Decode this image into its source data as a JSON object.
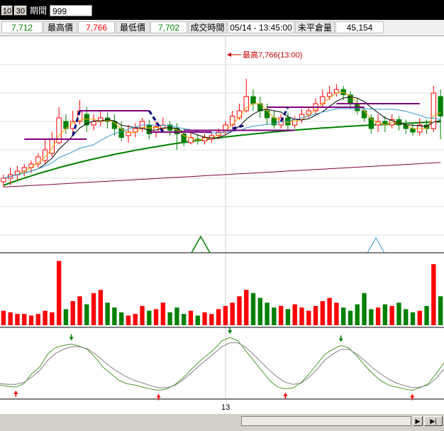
{
  "toolbar": {
    "btn_10": "10",
    "btn_30": "30",
    "period_label": "期間",
    "period_value": "999"
  },
  "info": {
    "last_value": "7,712",
    "high_label": "最高價",
    "high_value": "7,766",
    "low_label": "最低價",
    "low_value": "7,702",
    "time_label": "成交時間",
    "time_value": "05/14 - 13:45:00",
    "oi_label": "未平倉量",
    "oi_value": "45,154"
  },
  "colors": {
    "up": "#ff0000",
    "down": "#008000",
    "ma_long": "#008000",
    "ma_slow": "#800040",
    "ma_mid": "#000000",
    "ma_fast": "#ffa500",
    "ma_blue": "#3399cc",
    "box_line": "#800080",
    "dash_line": "#000080"
  },
  "chart_data": {
    "type": "candlestick",
    "annotation": "最高7,766(13:00)",
    "x_tick_label": "13",
    "price_axis_min": 7690,
    "price_axis_max": 7790,
    "candles": [
      [
        7708,
        7710,
        7705,
        7712
      ],
      [
        7710,
        7712,
        7706,
        7716
      ],
      [
        7712,
        7714,
        7709,
        7717
      ],
      [
        7714,
        7716,
        7711,
        7718
      ],
      [
        7716,
        7718,
        7713,
        7720
      ],
      [
        7718,
        7722,
        7716,
        7724
      ],
      [
        7720,
        7726,
        7718,
        7732
      ],
      [
        7724,
        7732,
        7722,
        7736
      ],
      [
        7730,
        7744,
        7729,
        7750
      ],
      [
        7742,
        7738,
        7735,
        7746
      ],
      [
        7738,
        7742,
        7734,
        7748
      ],
      [
        7742,
        7748,
        7740,
        7754
      ],
      [
        7746,
        7740,
        7736,
        7750
      ],
      [
        7740,
        7742,
        7737,
        7746
      ],
      [
        7742,
        7744,
        7739,
        7748
      ],
      [
        7744,
        7742,
        7738,
        7747
      ],
      [
        7742,
        7738,
        7734,
        7746
      ],
      [
        7738,
        7733,
        7731,
        7742
      ],
      [
        7734,
        7736,
        7730,
        7740
      ],
      [
        7736,
        7738,
        7733,
        7741
      ],
      [
        7738,
        7742,
        7736,
        7744
      ],
      [
        7740,
        7735,
        7732,
        7743
      ],
      [
        7736,
        7739,
        7733,
        7742
      ],
      [
        7738,
        7740,
        7736,
        7744
      ],
      [
        7740,
        7737,
        7734,
        7742
      ],
      [
        7738,
        7735,
        7726,
        7741
      ],
      [
        7735,
        7730,
        7728,
        7738
      ],
      [
        7730,
        7733,
        7729,
        7736
      ],
      [
        7732,
        7731,
        7729,
        7735
      ],
      [
        7731,
        7733,
        7729,
        7735
      ],
      [
        7732,
        7734,
        7730,
        7736
      ],
      [
        7734,
        7736,
        7732,
        7738
      ],
      [
        7736,
        7740,
        7734,
        7742
      ],
      [
        7740,
        7745,
        7739,
        7748
      ],
      [
        7744,
        7748,
        7743,
        7752
      ],
      [
        7748,
        7756,
        7747,
        7766
      ],
      [
        7756,
        7752,
        7748,
        7760
      ],
      [
        7752,
        7748,
        7744,
        7756
      ],
      [
        7748,
        7744,
        7740,
        7752
      ],
      [
        7744,
        7740,
        7738,
        7748
      ],
      [
        7740,
        7744,
        7738,
        7746
      ],
      [
        7744,
        7740,
        7737,
        7747
      ],
      [
        7740,
        7743,
        7738,
        7745
      ],
      [
        7743,
        7746,
        7741,
        7749
      ],
      [
        7746,
        7748,
        7744,
        7750
      ],
      [
        7748,
        7752,
        7746,
        7755
      ],
      [
        7752,
        7756,
        7750,
        7760
      ],
      [
        7756,
        7758,
        7754,
        7762
      ],
      [
        7758,
        7760,
        7756,
        7763
      ],
      [
        7760,
        7757,
        7754,
        7762
      ],
      [
        7757,
        7752,
        7749,
        7759
      ],
      [
        7752,
        7748,
        7746,
        7755
      ],
      [
        7748,
        7744,
        7742,
        7750
      ],
      [
        7744,
        7738,
        7735,
        7746
      ],
      [
        7740,
        7742,
        7736,
        7746
      ],
      [
        7742,
        7740,
        7736,
        7745
      ],
      [
        7740,
        7743,
        7738,
        7746
      ],
      [
        7743,
        7740,
        7737,
        7745
      ],
      [
        7740,
        7738,
        7735,
        7743
      ],
      [
        7738,
        7736,
        7734,
        7741
      ],
      [
        7736,
        7740,
        7734,
        7744
      ],
      [
        7740,
        7738,
        7735,
        7743
      ],
      [
        7738,
        7758,
        7736,
        7762
      ],
      [
        7756,
        7745,
        7732,
        7760
      ]
    ],
    "volume": [
      9,
      8,
      7,
      7,
      6,
      7,
      9,
      8,
      40,
      10,
      15,
      18,
      13,
      20,
      22,
      14,
      11,
      8,
      6,
      7,
      12,
      9,
      10,
      14,
      8,
      11,
      7,
      9,
      6,
      8,
      7,
      10,
      12,
      14,
      18,
      22,
      20,
      17,
      14,
      11,
      12,
      10,
      13,
      11,
      9,
      12,
      15,
      17,
      14,
      11,
      9,
      13,
      20,
      10,
      11,
      13,
      12,
      14,
      10,
      8,
      9,
      12,
      38,
      18
    ],
    "macd_fast": [
      18,
      16,
      15,
      20,
      35,
      45,
      65,
      75,
      78,
      80,
      77,
      72,
      60,
      45,
      35,
      25,
      20,
      18,
      15,
      12,
      10,
      12,
      18,
      28,
      40,
      52,
      62,
      72,
      85,
      90,
      85,
      70,
      55,
      40,
      25,
      15,
      12,
      14,
      22,
      35,
      50,
      65,
      72,
      78,
      74,
      62,
      48,
      35,
      25,
      18,
      15,
      12,
      10,
      14,
      20,
      35,
      52
    ],
    "macd_slow": [
      20,
      19,
      19,
      22,
      30,
      40,
      55,
      66,
      72,
      76,
      76,
      73,
      65,
      55,
      45,
      37,
      30,
      25,
      21,
      17,
      14,
      14,
      17,
      25,
      35,
      46,
      56,
      66,
      76,
      82,
      82,
      75,
      64,
      52,
      40,
      30,
      22,
      19,
      21,
      30,
      42,
      56,
      65,
      72,
      72,
      65,
      55,
      44,
      35,
      27,
      21,
      17,
      14,
      15,
      18,
      28,
      42
    ]
  }
}
